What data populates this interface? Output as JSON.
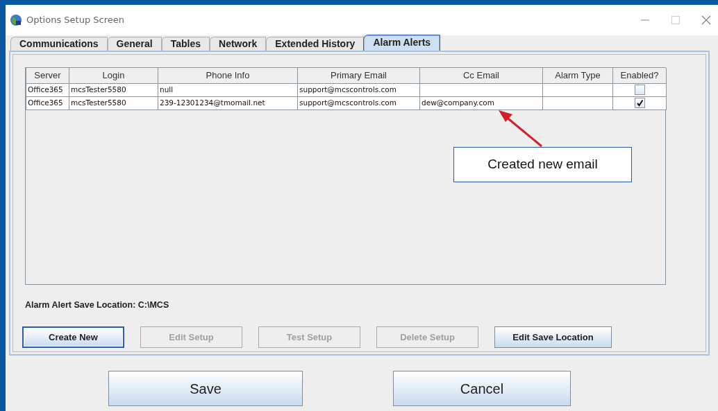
{
  "window": {
    "title": "Options Setup Screen"
  },
  "tabs": [
    {
      "label": "Communications",
      "selected": false
    },
    {
      "label": "General",
      "selected": false
    },
    {
      "label": "Tables",
      "selected": false
    },
    {
      "label": "Network",
      "selected": false
    },
    {
      "label": "Extended History",
      "selected": false
    },
    {
      "label": "Alarm Alerts",
      "selected": true
    }
  ],
  "table": {
    "columns": [
      "Server",
      "Login",
      "Phone Info",
      "Primary Email",
      "Cc Email",
      "Alarm Type",
      "Enabled?"
    ],
    "rows": [
      {
        "cells": [
          "Office365",
          "mcsTester5580",
          "null",
          "support@mcscontrols.com",
          "",
          ""
        ],
        "enabled": false
      },
      {
        "cells": [
          "Office365",
          "mcsTester5580",
          "239-12301234@tmomail.net",
          "support@mcscontrols.com",
          "dew@company.com",
          ""
        ],
        "enabled": true
      }
    ]
  },
  "callout": {
    "text": "Created new email"
  },
  "save_location": {
    "label": "Alarm Alert Save Location: C:\\MCS"
  },
  "buttons": [
    {
      "label": "Create New",
      "disabled": false,
      "focused": true
    },
    {
      "label": "Edit Setup",
      "disabled": true,
      "focused": false
    },
    {
      "label": "Test Setup",
      "disabled": true,
      "focused": false
    },
    {
      "label": "Delete Setup",
      "disabled": true,
      "focused": false
    },
    {
      "label": "Edit Save Location",
      "disabled": false,
      "focused": false
    }
  ],
  "dialog_buttons": [
    "Save",
    "Cancel"
  ]
}
